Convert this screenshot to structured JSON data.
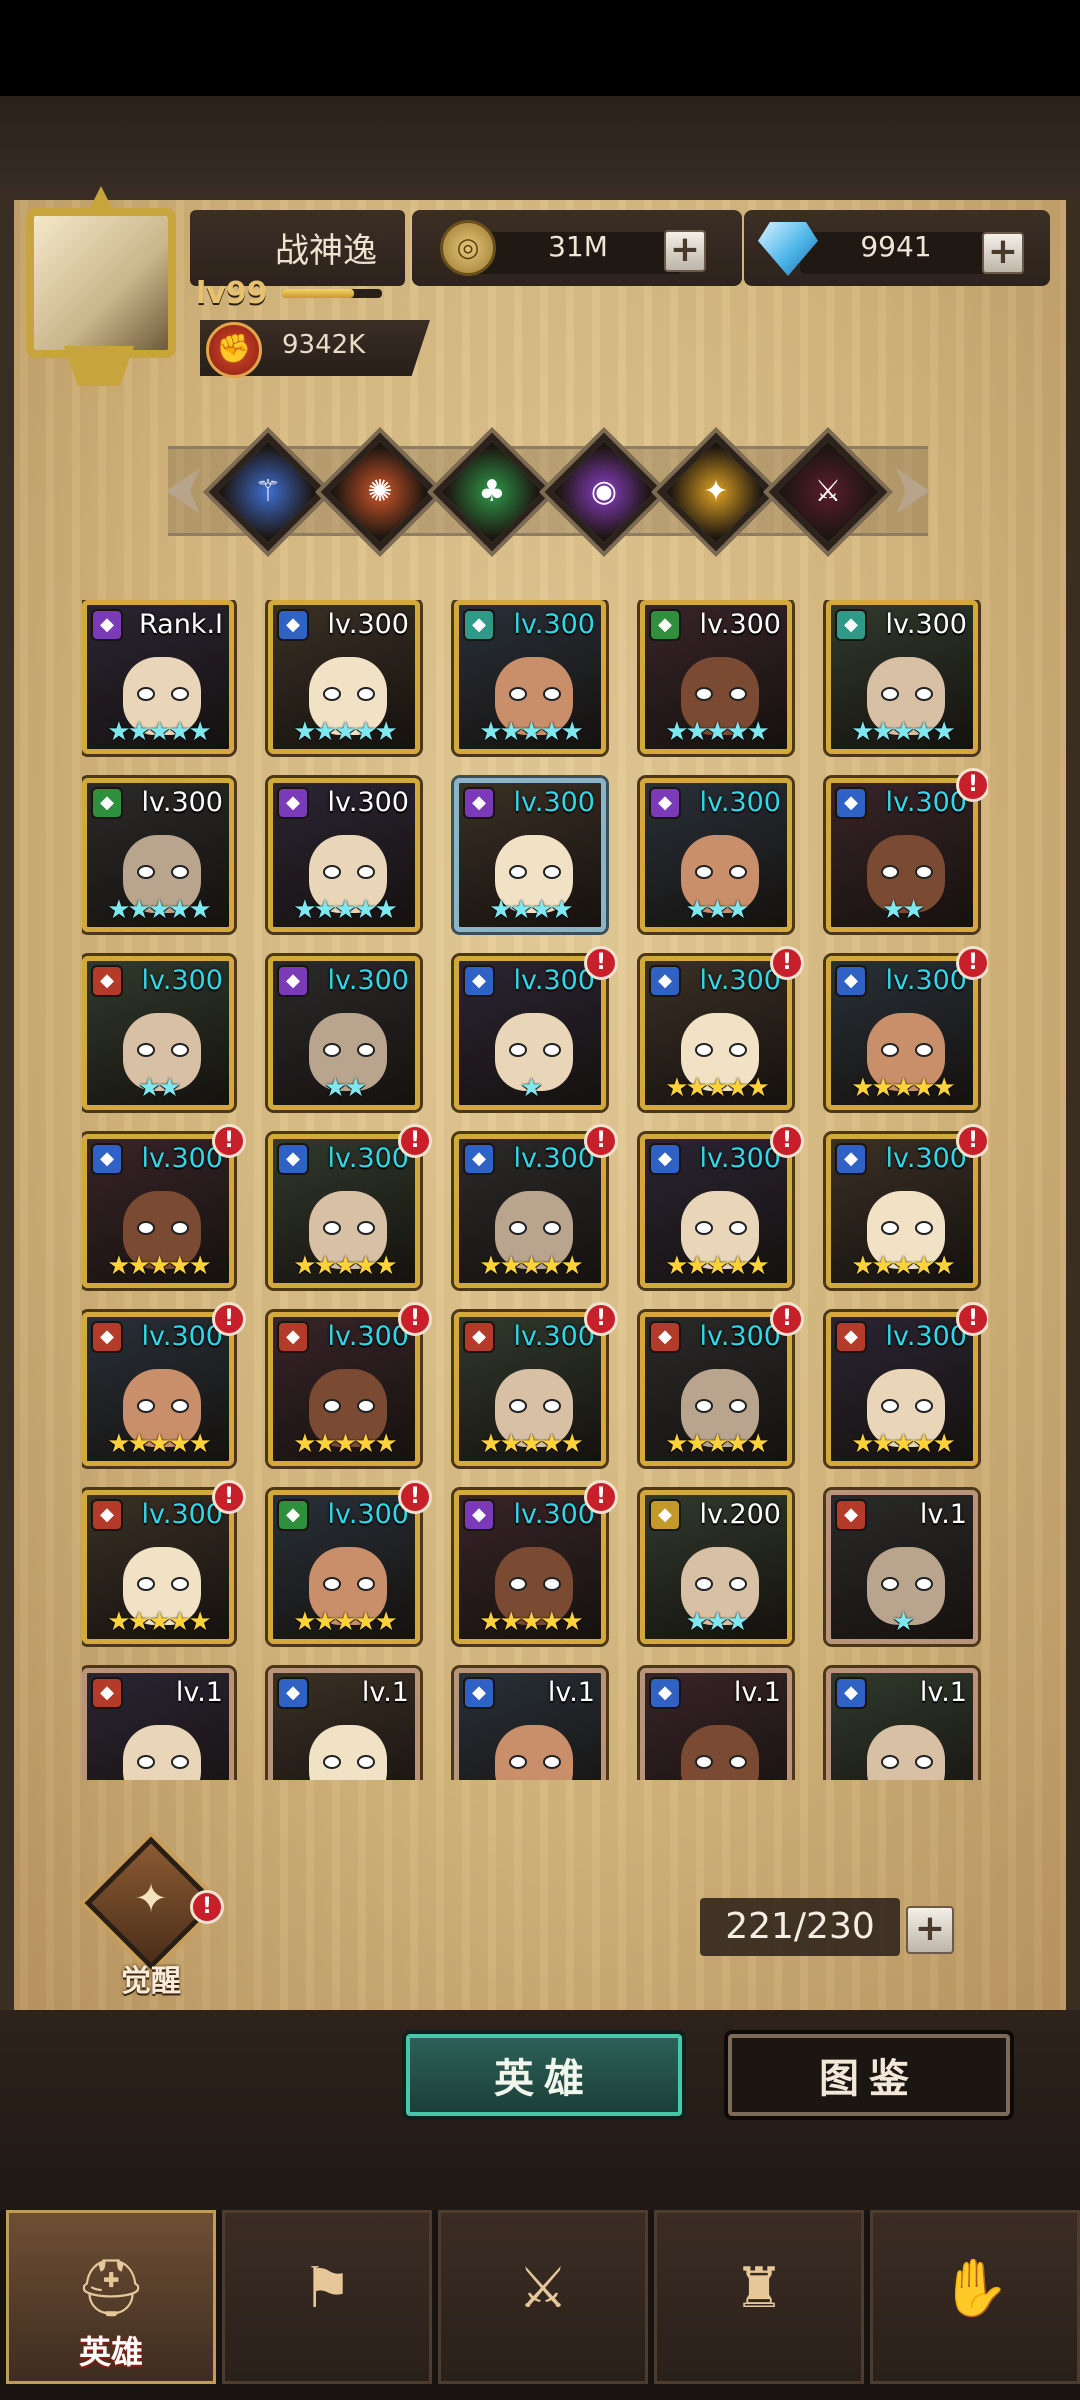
{
  "player": {
    "name": "战神逸",
    "level_label": "lv99",
    "exp_fraction": 0.72,
    "power": "9342K"
  },
  "currency": {
    "gold": "31M",
    "gems": "9941"
  },
  "element_filters": [
    {
      "name": "water-element-icon",
      "color": "#3f6fd0"
    },
    {
      "name": "fire-element-icon",
      "color": "#d0582a"
    },
    {
      "name": "nature-element-icon",
      "color": "#2f9a4a"
    },
    {
      "name": "arcane-element-icon",
      "color": "#8a3fc4"
    },
    {
      "name": "light-element-icon",
      "color": "#e0a323"
    },
    {
      "name": "dark-element-icon",
      "color": "#5a1d2c"
    }
  ],
  "heroes": [
    {
      "level": "Rank.I",
      "level_color": "white",
      "stars": 5,
      "star_color": "cyan",
      "class": "purple",
      "alert": false
    },
    {
      "level": "lv.300",
      "level_color": "white",
      "stars": 5,
      "star_color": "cyan",
      "class": "blue",
      "alert": false
    },
    {
      "level": "lv.300",
      "level_color": "cyan",
      "stars": 5,
      "star_color": "cyan",
      "class": "teal",
      "alert": false
    },
    {
      "level": "lv.300",
      "level_color": "white",
      "stars": 5,
      "star_color": "cyan",
      "class": "green",
      "alert": false
    },
    {
      "level": "lv.300",
      "level_color": "white",
      "stars": 5,
      "star_color": "cyan",
      "class": "teal",
      "alert": false
    },
    {
      "level": "lv.300",
      "level_color": "white",
      "stars": 5,
      "star_color": "cyan",
      "class": "green",
      "alert": false
    },
    {
      "level": "lv.300",
      "level_color": "white",
      "stars": 5,
      "star_color": "cyan",
      "class": "purple",
      "alert": false
    },
    {
      "level": "lv.300",
      "level_color": "cyan",
      "stars": 4,
      "star_color": "cyan",
      "class": "purple",
      "alert": false
    },
    {
      "level": "lv.300",
      "level_color": "cyan",
      "stars": 3,
      "star_color": "cyan",
      "class": "purple",
      "alert": false
    },
    {
      "level": "lv.300",
      "level_color": "cyan",
      "stars": 2,
      "star_color": "cyan",
      "class": "blue",
      "alert": true
    },
    {
      "level": "lv.300",
      "level_color": "cyan",
      "stars": 2,
      "star_color": "cyan",
      "class": "red",
      "alert": false
    },
    {
      "level": "lv.300",
      "level_color": "cyan",
      "stars": 2,
      "star_color": "cyan",
      "class": "purple",
      "alert": false
    },
    {
      "level": "lv.300",
      "level_color": "cyan",
      "stars": 1,
      "star_color": "cyan",
      "class": "blue",
      "alert": true
    },
    {
      "level": "lv.300",
      "level_color": "cyan",
      "stars": 5,
      "star_color": "gold",
      "class": "blue",
      "alert": true
    },
    {
      "level": "lv.300",
      "level_color": "cyan",
      "stars": 5,
      "star_color": "gold",
      "class": "blue",
      "alert": true
    },
    {
      "level": "lv.300",
      "level_color": "cyan",
      "stars": 5,
      "star_color": "gold",
      "class": "blue",
      "alert": true
    },
    {
      "level": "lv.300",
      "level_color": "cyan",
      "stars": 5,
      "star_color": "gold",
      "class": "blue",
      "alert": true
    },
    {
      "level": "lv.300",
      "level_color": "cyan",
      "stars": 5,
      "star_color": "gold",
      "class": "blue",
      "alert": true
    },
    {
      "level": "lv.300",
      "level_color": "cyan",
      "stars": 5,
      "star_color": "gold",
      "class": "blue",
      "alert": true
    },
    {
      "level": "lv.300",
      "level_color": "cyan",
      "stars": 5,
      "star_color": "gold",
      "class": "blue",
      "alert": true
    },
    {
      "level": "lv.300",
      "level_color": "cyan",
      "stars": 5,
      "star_color": "gold",
      "class": "red",
      "alert": true
    },
    {
      "level": "lv.300",
      "level_color": "cyan",
      "stars": 5,
      "star_color": "gold",
      "class": "red",
      "alert": true
    },
    {
      "level": "lv.300",
      "level_color": "cyan",
      "stars": 5,
      "star_color": "gold",
      "class": "red",
      "alert": true
    },
    {
      "level": "lv.300",
      "level_color": "cyan",
      "stars": 5,
      "star_color": "gold",
      "class": "red",
      "alert": true
    },
    {
      "level": "lv.300",
      "level_color": "cyan",
      "stars": 5,
      "star_color": "gold",
      "class": "red",
      "alert": true
    },
    {
      "level": "lv.300",
      "level_color": "cyan",
      "stars": 5,
      "star_color": "gold",
      "class": "red",
      "alert": true
    },
    {
      "level": "lv.300",
      "level_color": "cyan",
      "stars": 5,
      "star_color": "gold",
      "class": "green",
      "alert": true
    },
    {
      "level": "lv.300",
      "level_color": "cyan",
      "stars": 5,
      "star_color": "gold",
      "class": "purple",
      "alert": true
    },
    {
      "level": "lv.200",
      "level_color": "white",
      "stars": 3,
      "star_color": "cyan",
      "class": "gold",
      "alert": false
    },
    {
      "level": "lv.1",
      "level_color": "white",
      "stars": 1,
      "star_color": "cyan",
      "class": "red",
      "alert": false
    },
    {
      "level": "lv.1",
      "level_color": "white",
      "stars": 0,
      "star_color": "cyan",
      "class": "red",
      "alert": false
    },
    {
      "level": "lv.1",
      "level_color": "white",
      "stars": 0,
      "star_color": "cyan",
      "class": "blue",
      "alert": false
    },
    {
      "level": "lv.1",
      "level_color": "white",
      "stars": 0,
      "star_color": "cyan",
      "class": "blue",
      "alert": false
    },
    {
      "level": "lv.1",
      "level_color": "white",
      "stars": 0,
      "star_color": "cyan",
      "class": "blue",
      "alert": false
    },
    {
      "level": "lv.1",
      "level_color": "white",
      "stars": 0,
      "star_color": "cyan",
      "class": "blue",
      "alert": false
    }
  ],
  "awaken": {
    "label": "觉醒",
    "alert": true
  },
  "capacity": "221/230",
  "tabs": {
    "heroes": "英雄",
    "codex": "图鉴"
  },
  "nav": [
    {
      "name": "nav-heroes",
      "icon": "helmet-icon",
      "label": "英雄",
      "active": true
    },
    {
      "name": "nav-adventure",
      "icon": "flag-icon",
      "label": "",
      "active": false
    },
    {
      "name": "nav-battle",
      "icon": "crossed-swords-icon",
      "label": "",
      "active": false
    },
    {
      "name": "nav-castle",
      "icon": "castle-icon",
      "label": "",
      "active": false
    },
    {
      "name": "nav-guild",
      "icon": "handshake-icon",
      "label": "",
      "active": false
    }
  ],
  "colors": {
    "class": {
      "purple": "#7b3bb8",
      "blue": "#2f62c4",
      "teal": "#2f9a88",
      "green": "#2e8f3c",
      "red": "#b43a2a",
      "gold": "#c39a2a"
    }
  }
}
